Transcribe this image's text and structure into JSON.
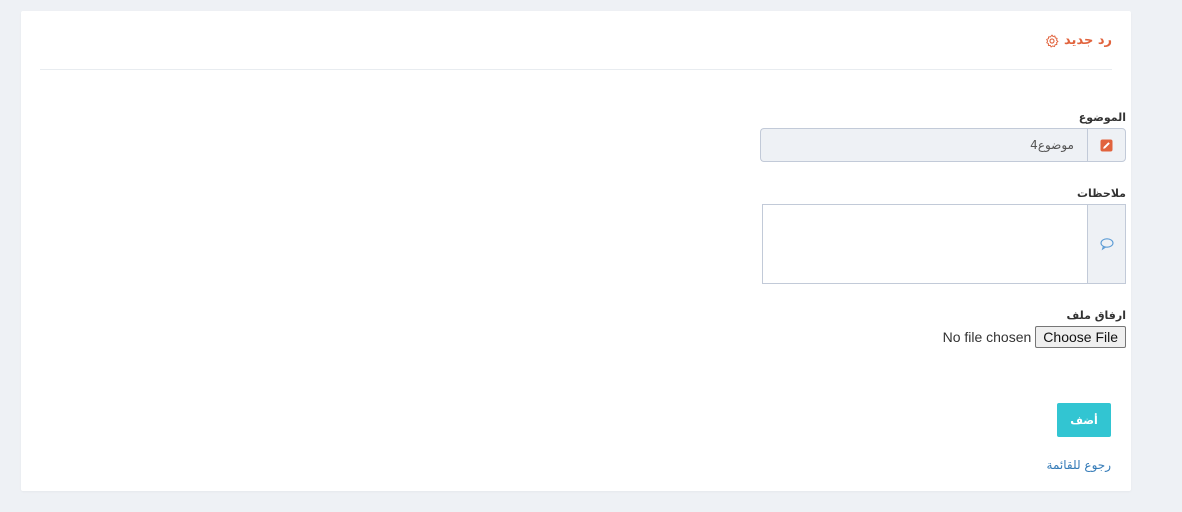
{
  "header": {
    "title": "رد جديد",
    "icon": "gear-icon",
    "accent_color": "#e1633d"
  },
  "form": {
    "subject": {
      "label": "الموضوع",
      "value": "موضوع4",
      "icon": "pencil-icon"
    },
    "notes": {
      "label": "ملاحظات",
      "value": "",
      "icon": "comment-icon"
    },
    "attachment": {
      "label": "ارفاق ملف",
      "button_label": "Choose File",
      "status_text": "No file chosen"
    },
    "submit_label": "أضف",
    "submit_color": "#32c5d2"
  },
  "footer": {
    "back_link": "رجوع للقائمة"
  }
}
